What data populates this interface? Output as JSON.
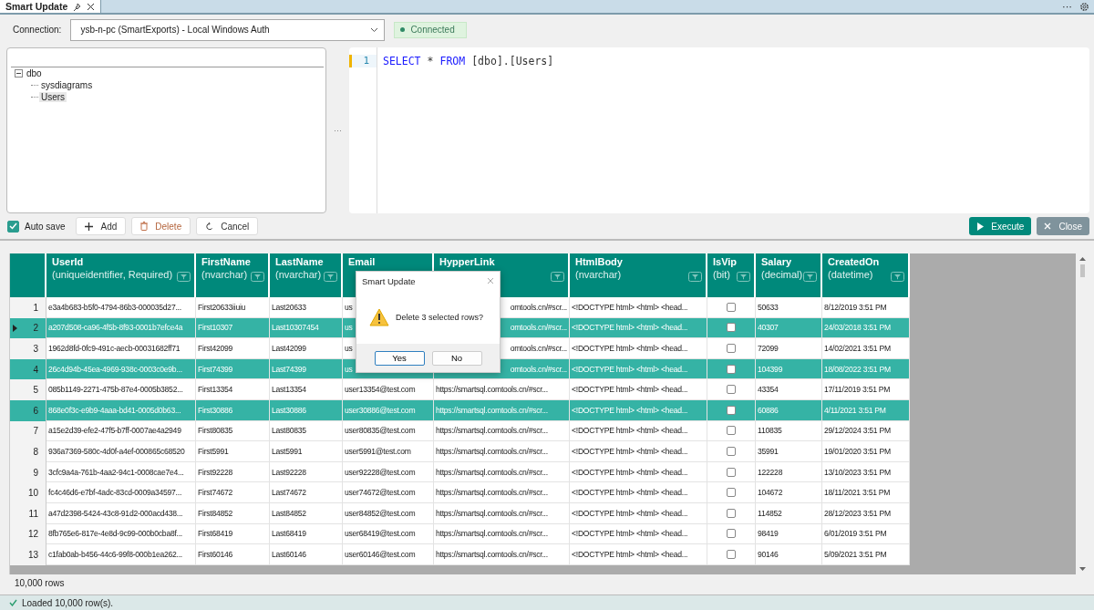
{
  "tab": {
    "title": "Smart Update",
    "selected": true
  },
  "topbar": {
    "more": "···"
  },
  "splitter": "···",
  "connection": {
    "label": "Connection:",
    "value": "ysb-n-pc (SmartExports) - Local Windows Auth",
    "status": "Connected"
  },
  "tree": {
    "items": [
      {
        "label": "dbo",
        "expanded": true,
        "selected": false,
        "children": [
          {
            "label": "sysdiagrams",
            "selected": false
          },
          {
            "label": "Users",
            "selected": true
          }
        ]
      }
    ]
  },
  "editor": {
    "lines": [
      {
        "number": "1",
        "tokens": [
          {
            "text": "SELECT",
            "kind": "keyword"
          },
          {
            "text": "*",
            "kind": "plain"
          },
          {
            "text": "FROM",
            "kind": "keyword"
          },
          {
            "text": "[dbo].[Users]",
            "kind": "plain"
          }
        ]
      }
    ]
  },
  "toolbar": {
    "auto_save": {
      "label": "Auto save",
      "checked": true
    },
    "add": "Add",
    "delete": "Delete",
    "cancel": "Cancel",
    "execute": "Execute",
    "close": "Close"
  },
  "grid": {
    "columns": [
      {
        "name": "UserId",
        "type": "(uniqueidentifier, Required)",
        "kind": "text",
        "filter": true
      },
      {
        "name": "FirstName",
        "type": "(nvarchar)",
        "kind": "text",
        "filter": true
      },
      {
        "name": "LastName",
        "type": "(nvarchar)",
        "kind": "text",
        "filter": true
      },
      {
        "name": "Email",
        "kind": "text",
        "filter": false
      },
      {
        "name": "HypperLink",
        "kind": "text",
        "filter": true
      },
      {
        "name": "HtmlBody",
        "type": "(nvarchar)",
        "kind": "text",
        "filter": true
      },
      {
        "name": "IsVip",
        "type": "(bit)",
        "kind": "check",
        "filter": true
      },
      {
        "name": "Salary",
        "type": "(decimal)",
        "kind": "text",
        "filter": true
      },
      {
        "name": "CreatedOn",
        "type": "(datetime)",
        "kind": "text",
        "filter": true
      }
    ],
    "rows": [
      {
        "number": "1",
        "selected": false,
        "current": false,
        "covered": true,
        "cells": [
          "e3a4b683-b5f0-4794-86b3-000035d27...",
          "First20633iiuiu",
          "Last20633",
          "us",
          "omtools.cn/#scr...",
          "<!DOCTYPE html> <html> <head...",
          false,
          "50633",
          "8/12/2019 3:51 PM"
        ]
      },
      {
        "number": "2",
        "selected": true,
        "current": true,
        "covered": true,
        "cells": [
          "a207d508-ca96-4f5b-8f93-0001b7efce4a",
          "First10307",
          "Last10307454",
          "us",
          "omtools.cn/#scr...",
          "<!DOCTYPE html> <html> <head...",
          false,
          "40307",
          "24/03/2018 3:51 PM"
        ]
      },
      {
        "number": "3",
        "selected": false,
        "current": false,
        "covered": true,
        "cells": [
          "1962d8fd-0fc9-491c-aecb-00031682ff71",
          "First42099",
          "Last42099",
          "us",
          "omtools.cn/#scr...",
          "<!DOCTYPE html> <html> <head...",
          false,
          "72099",
          "14/02/2021 3:51 PM"
        ]
      },
      {
        "number": "4",
        "selected": true,
        "current": false,
        "covered": true,
        "cells": [
          "26c4d94b-45ea-4969-938c-0003c0e9b...",
          "First74399",
          "Last74399",
          "us",
          "omtools.cn/#scr...",
          "<!DOCTYPE html> <html> <head...",
          false,
          "104399",
          "18/08/2022 3:51 PM"
        ]
      },
      {
        "number": "5",
        "selected": false,
        "current": false,
        "covered": false,
        "cells": [
          "085b1149-2271-475b-87e4-0005b3852...",
          "First13354",
          "Last13354",
          "user13354@test.com",
          "https://smartsql.comtools.cn/#scr...",
          "<!DOCTYPE html> <html> <head...",
          false,
          "43354",
          "17/11/2019 3:51 PM"
        ]
      },
      {
        "number": "6",
        "selected": true,
        "current": false,
        "covered": false,
        "cells": [
          "868e0f3c-e9b9-4aaa-bd41-0005d0b63...",
          "First30886",
          "Last30886",
          "user30886@test.com",
          "https://smartsql.comtools.cn/#scr...",
          "<!DOCTYPE html> <html> <head...",
          false,
          "60886",
          "4/11/2021 3:51 PM"
        ]
      },
      {
        "number": "7",
        "selected": false,
        "current": false,
        "covered": false,
        "cells": [
          "a15e2d39-efe2-47f5-b7ff-0007ae4a2949",
          "First80835",
          "Last80835",
          "user80835@test.com",
          "https://smartsql.comtools.cn/#scr...",
          "<!DOCTYPE html> <html> <head...",
          false,
          "110835",
          "29/12/2024 3:51 PM"
        ]
      },
      {
        "number": "8",
        "selected": false,
        "current": false,
        "covered": false,
        "cells": [
          "936a7369-580c-4d0f-a4ef-000865c68520",
          "First5991",
          "Last5991",
          "user5991@test.com",
          "https://smartsql.comtools.cn/#scr...",
          "<!DOCTYPE html> <html> <head...",
          false,
          "35991",
          "19/01/2020 3:51 PM"
        ]
      },
      {
        "number": "9",
        "selected": false,
        "current": false,
        "covered": false,
        "cells": [
          "3cfc9a4a-761b-4aa2-94c1-0008cae7e4...",
          "First92228",
          "Last92228",
          "user92228@test.com",
          "https://smartsql.comtools.cn/#scr...",
          "<!DOCTYPE html> <html> <head...",
          false,
          "122228",
          "13/10/2023 3:51 PM"
        ]
      },
      {
        "number": "10",
        "selected": false,
        "current": false,
        "covered": false,
        "cells": [
          "fc4c46d6-e7bf-4adc-83cd-0009a34597...",
          "First74672",
          "Last74672",
          "user74672@test.com",
          "https://smartsql.comtools.cn/#scr...",
          "<!DOCTYPE html> <html> <head...",
          false,
          "104672",
          "18/11/2021 3:51 PM"
        ]
      },
      {
        "number": "11",
        "selected": false,
        "current": false,
        "covered": false,
        "cells": [
          "a47d2398-5424-43c8-91d2-000acd438...",
          "First84852",
          "Last84852",
          "user84852@test.com",
          "https://smartsql.comtools.cn/#scr...",
          "<!DOCTYPE html> <html> <head...",
          false,
          "114852",
          "28/12/2023 3:51 PM"
        ]
      },
      {
        "number": "12",
        "selected": false,
        "current": false,
        "covered": false,
        "cells": [
          "8fb765e6-817e-4e8d-9c99-000b0cba8f...",
          "First68419",
          "Last68419",
          "user68419@test.com",
          "https://smartsql.comtools.cn/#scr...",
          "<!DOCTYPE html> <html> <head...",
          false,
          "98419",
          "6/01/2019 3:51 PM"
        ]
      },
      {
        "number": "13",
        "selected": false,
        "current": false,
        "covered": false,
        "cells": [
          "c1fab0ab-b456-44c6-99f8-000b1ea262...",
          "First60146",
          "Last60146",
          "user60146@test.com",
          "https://smartsql.comtools.cn/#scr...",
          "<!DOCTYPE html> <html> <head...",
          false,
          "90146",
          "5/09/2021 3:51 PM"
        ]
      }
    ],
    "row_count": "10,000 rows"
  },
  "dialog": {
    "title": "Smart Update",
    "message": "Delete 3 selected rows?",
    "buttons": [
      {
        "label": "Yes",
        "focused": true
      },
      {
        "label": "No",
        "focused": false
      }
    ]
  },
  "status_bar": {
    "text": "Loaded 10,000 row(s)."
  }
}
